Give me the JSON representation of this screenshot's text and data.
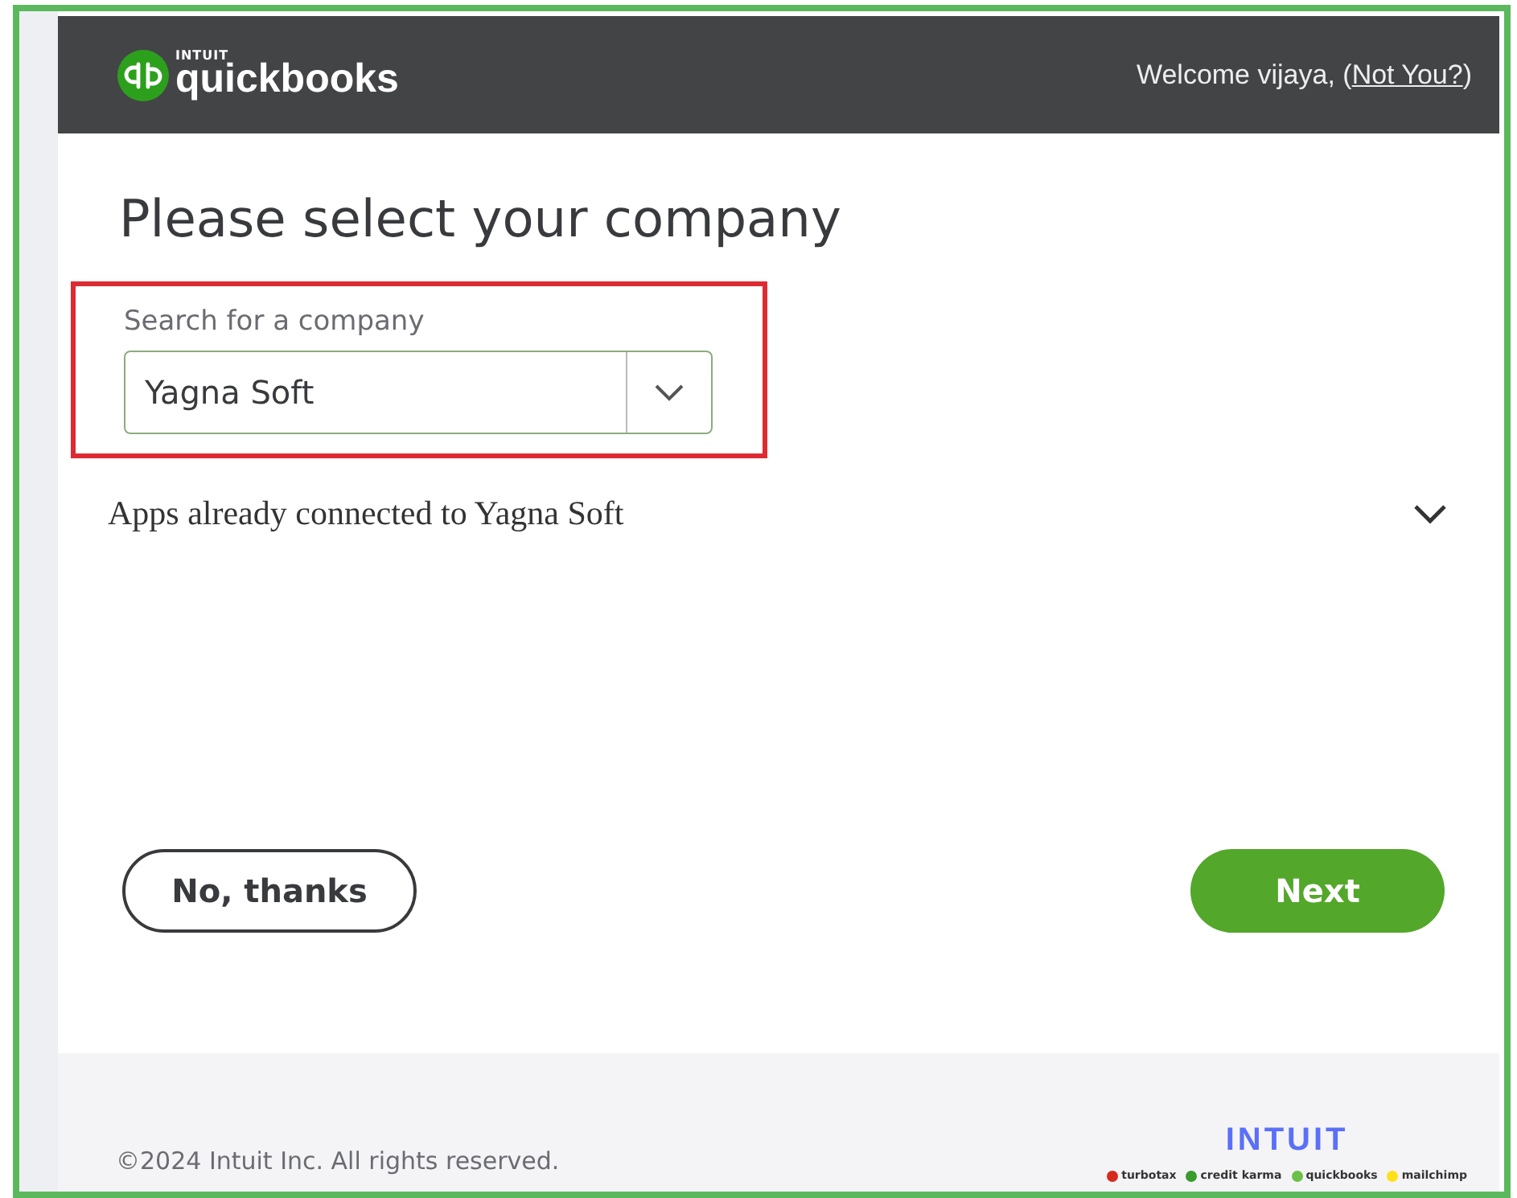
{
  "header": {
    "logo_small": "INTUIT",
    "logo": "quickbooks",
    "welcome": "Welcome vijaya, (",
    "not_you_link": "Not You?",
    "welcome_end": ")"
  },
  "title": "Please select your company",
  "company_search": {
    "label": "Search for a company",
    "value": "Yagna Soft",
    "highlighted": true
  },
  "apps_section": {
    "label": "Apps already connected to Yagna Soft",
    "expanded": false
  },
  "buttons": [
    {
      "kind": "secondary",
      "label": "No, thanks"
    },
    {
      "kind": "primary",
      "label": "Next"
    }
  ],
  "footer": {
    "copyright": "©2024 Intuit Inc. All rights reserved.",
    "brand": "INTUIT",
    "products": [
      {
        "name": "turbotax",
        "color": "#d52b1e"
      },
      {
        "name": "credit karma",
        "color": "#3a9b2e"
      },
      {
        "name": "quickbooks",
        "color": "#6cc04a"
      },
      {
        "name": "mailchimp",
        "color": "#ffe01b"
      }
    ]
  }
}
